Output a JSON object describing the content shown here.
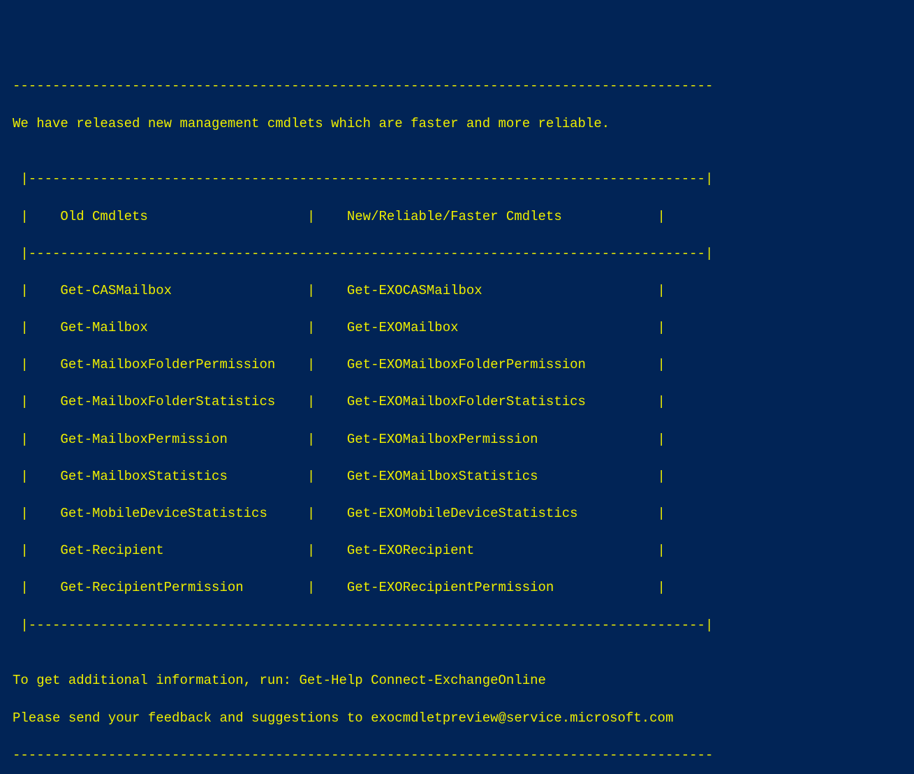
{
  "separator_top": "----------------------------------------------------------------------------------------",
  "intro": "We have released new management cmdlets which are faster and more reliable.",
  "blank": "",
  "table_border_top": " |-------------------------------------------------------------------------------------|",
  "header_line": " |    Old Cmdlets                    |    New/Reliable/Faster Cmdlets            |",
  "table_border_mid": " |-------------------------------------------------------------------------------------|",
  "rows": [
    " |    Get-CASMailbox                 |    Get-EXOCASMailbox                      |",
    " |    Get-Mailbox                    |    Get-EXOMailbox                         |",
    " |    Get-MailboxFolderPermission    |    Get-EXOMailboxFolderPermission         |",
    " |    Get-MailboxFolderStatistics    |    Get-EXOMailboxFolderStatistics         |",
    " |    Get-MailboxPermission          |    Get-EXOMailboxPermission               |",
    " |    Get-MailboxStatistics          |    Get-EXOMailboxStatistics               |",
    " |    Get-MobileDeviceStatistics     |    Get-EXOMobileDeviceStatistics          |",
    " |    Get-Recipient                  |    Get-EXORecipient                       |",
    " |    Get-RecipientPermission        |    Get-EXORecipientPermission             |"
  ],
  "table_border_bottom": " |-------------------------------------------------------------------------------------|",
  "help_line": "To get additional information, run: Get-Help Connect-ExchangeOnline",
  "feedback_line": "Please send your feedback and suggestions to exocmdletpreview@service.microsoft.com",
  "separator_bottom": "----------------------------------------------------------------------------------------"
}
